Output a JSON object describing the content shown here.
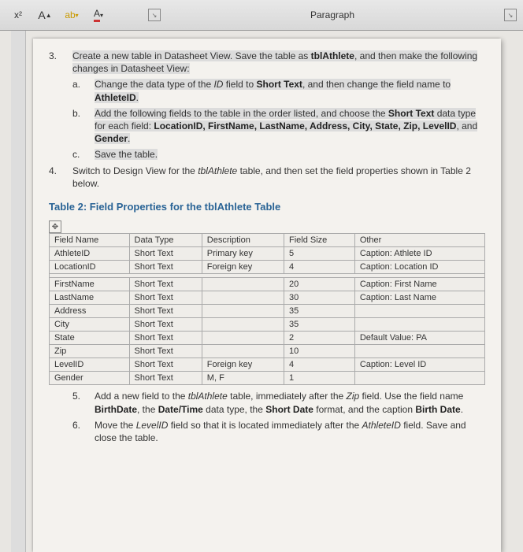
{
  "ribbon": {
    "group_label": "Paragraph",
    "x2": "x²",
    "a_hi": "A",
    "a_lo": "A"
  },
  "step3": {
    "marker": "3.",
    "text_a": "Create a new table in Datasheet View. Save the table as ",
    "tbl": "tblAthlete",
    "text_b": ", and then make the following changes in Datasheet View:"
  },
  "step3a": {
    "marker": "a.",
    "t1": "Change the data type of the ",
    "id": "ID",
    "t2": " field to ",
    "st": "Short Text",
    "t3": ", and then change the field name to ",
    "aid": "AthleteID",
    "t4": "."
  },
  "step3b": {
    "marker": "b.",
    "t1": "Add the following fields to the table in the order listed, and choose the ",
    "st": "Short Text",
    "t2": " data type for each field: ",
    "fields": "LocationID, FirstName, LastName, Address, City, State, Zip, LevelID",
    "t3": ", and ",
    "gender": "Gender",
    "t4": "."
  },
  "step3c": {
    "marker": "c.",
    "t1": "Save the table."
  },
  "step4": {
    "marker": "4.",
    "t1": "Switch to Design View for the ",
    "tbl": "tblAthlete",
    "t2": " table, and then set the field properties shown in Table 2 below."
  },
  "table_title": "Table 2: Field Properties for the tblAthlete Table",
  "headers": {
    "c1": "Field Name",
    "c2": "Data Type",
    "c3": "Description",
    "c4": "Field Size",
    "c5": "Other"
  },
  "rows": [
    {
      "c1": "AthleteID",
      "c2": "Short Text",
      "c3": "Primary key",
      "c4": "5",
      "c5": "Caption: Athlete ID"
    },
    {
      "c1": "LocationID",
      "c2": "Short Text",
      "c3": "Foreign key",
      "c4": "4",
      "c5": "Caption: Location ID"
    },
    {
      "c1": "FirstName",
      "c2": "Short Text",
      "c3": "",
      "c4": "20",
      "c5": "Caption: First Name"
    },
    {
      "c1": "LastName",
      "c2": "Short Text",
      "c3": "",
      "c4": "30",
      "c5": "Caption: Last Name"
    },
    {
      "c1": "Address",
      "c2": "Short Text",
      "c3": "",
      "c4": "35",
      "c5": ""
    },
    {
      "c1": "City",
      "c2": "Short Text",
      "c3": "",
      "c4": "35",
      "c5": ""
    },
    {
      "c1": "State",
      "c2": "Short Text",
      "c3": "",
      "c4": "2",
      "c5": "Default Value: PA"
    },
    {
      "c1": "Zip",
      "c2": "Short Text",
      "c3": "",
      "c4": "10",
      "c5": ""
    },
    {
      "c1": "LevelID",
      "c2": "Short Text",
      "c3": "Foreign key",
      "c4": "4",
      "c5": "Caption: Level ID"
    },
    {
      "c1": "Gender",
      "c2": "Short Text",
      "c3": "M, F",
      "c4": "1",
      "c5": ""
    }
  ],
  "step5": {
    "marker": "5.",
    "t1": "Add a new field to the ",
    "tbl": "tblAthlete",
    "t2": " table, immediately after the ",
    "zip": "Zip",
    "t3": " field. Use the field name ",
    "bd": "BirthDate",
    "t4": ", the ",
    "dt": "Date/Time",
    "t5": " data type, the ",
    "sd": "Short Date",
    "t6": " format, and the caption ",
    "cap": "Birth Date",
    "t7": "."
  },
  "step6": {
    "marker": "6.",
    "t1": "Move the ",
    "lvl": "LevelID",
    "t2": " field so that it is located immediately after the ",
    "aid": "AthleteID",
    "t3": " field. Save and close the table."
  }
}
